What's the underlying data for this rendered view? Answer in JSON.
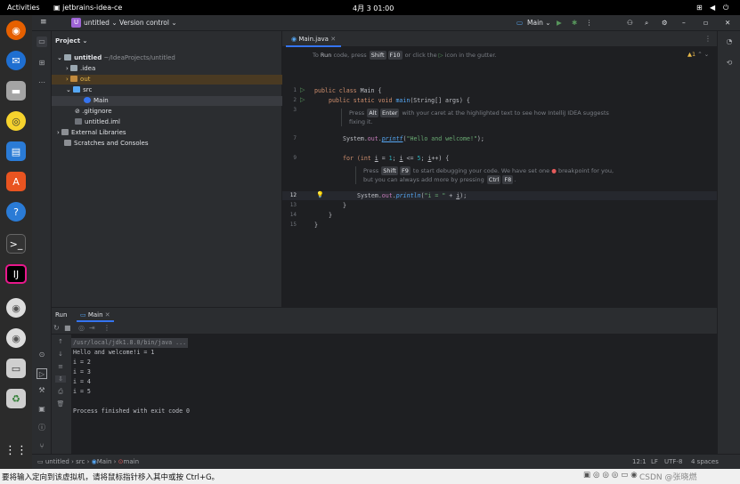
{
  "topbar": {
    "activities": "Activities",
    "app": "jetbrains-idea-ce",
    "clock": "4月 3  01:00"
  },
  "ide": {
    "project_badge": "U",
    "project_name": "untitled",
    "vcs": "Version control",
    "run_config": "Main",
    "project_panel_title": "Project",
    "tree": [
      {
        "label": "untitled",
        "hint": "~/IdeaProjects/untitled"
      },
      {
        "label": ".idea"
      },
      {
        "label": "out"
      },
      {
        "label": "src"
      },
      {
        "label": "Main"
      },
      {
        "label": ".gitignore"
      },
      {
        "label": "untitled.iml"
      },
      {
        "label": "External Libraries"
      },
      {
        "label": "Scratches and Consoles"
      }
    ],
    "tab": "Main.java",
    "warnings": "1",
    "hint_line": {
      "a": "To ",
      "b": "Run",
      "c": " code, press ",
      "k1": "Shift",
      "k2": "F10",
      "d": " or click the ",
      "e": " icon in the gutter."
    },
    "code": {
      "l1_kw": "public class ",
      "l1_rest": "Main {",
      "l2_kw": "public static void ",
      "l2_fn": "main",
      "l2_rest": "(String[] args) {",
      "doc1a": "Press ",
      "doc1k1": "Alt",
      "doc1k2": "Enter",
      "doc1b": " with your caret at the highlighted text to see how IntelliJ IDEA suggests",
      "doc1c": "fixing it.",
      "l7_a": "System.",
      "l7_b": "out",
      "l7_c": ".",
      "l7_d": "printf",
      "l7_e": "(",
      "l7_f": "\"Hello and welcome!\"",
      "l7_g": ");",
      "l9_a": "for ",
      "l9_b": "(int ",
      "l9_c": "i",
      "l9_d": " = ",
      "l9_e": "1",
      "l9_f": "; ",
      "l9_g": "i",
      "l9_h": " <= ",
      "l9_i": "5",
      "l9_j": "; ",
      "l9_k": "i",
      "l9_l": "++) {",
      "doc2a": "Press ",
      "doc2k1": "Shift",
      "doc2k2": "F9",
      "doc2b": " to start debugging your code. We have set one ",
      "doc2c": " breakpoint for you,",
      "doc2d": "but you can always add more by pressing ",
      "doc2k3": "Ctrl",
      "doc2k4": "F8",
      "doc2e": ".",
      "l12_a": "System.",
      "l12_b": "out",
      "l12_c": ".",
      "l12_d": "println",
      "l12_e": "(",
      "l12_f": "\"i = \"",
      "l12_g": " + ",
      "l12_h": "i",
      "l12_i": ");",
      "l13": "}",
      "l14": "}",
      "l15": "}"
    },
    "line_numbers": [
      "1",
      "2",
      "3",
      "",
      "",
      "",
      "7",
      "",
      "9",
      "",
      "",
      "12",
      "13",
      "14",
      "15"
    ],
    "run_tab": "Run",
    "run_subtab": "Main",
    "console": [
      "/usr/local/jdk1.8.0/bin/java ...",
      "Hello and welcome!i = 1",
      "i = 2",
      "i = 3",
      "i = 4",
      "i = 5",
      "",
      "Process finished with exit code 0"
    ],
    "status": {
      "p1": "untitled",
      "p2": "src",
      "p3": "Main",
      "p4": "main",
      "pos": "12:1",
      "lf": "LF",
      "enc": "UTF-8",
      "spaces": "4 spaces"
    }
  },
  "host": {
    "hint": "要将输入定向到该虚拟机，请将鼠标指针移入其中或按 Ctrl+G。",
    "watermark": "CSDN @张晓燃"
  }
}
